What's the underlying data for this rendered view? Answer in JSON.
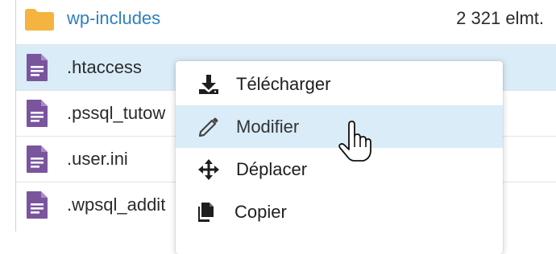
{
  "files": {
    "rows": [
      {
        "name": ".htaccess",
        "type": "file",
        "meta": ""
      },
      {
        "name": ".pssql_tutow",
        "type": "file",
        "meta": ""
      },
      {
        "name": ".user.ini",
        "type": "file",
        "meta": ""
      },
      {
        "name": ".wpsql_addit",
        "type": "file",
        "meta": ""
      }
    ],
    "folder": {
      "name": "wp-includes",
      "meta": "2 321 elmt."
    }
  },
  "context_menu": {
    "items": [
      {
        "label": "Télécharger",
        "icon": "download-icon"
      },
      {
        "label": "Modifier",
        "icon": "pencil-icon"
      },
      {
        "label": "Déplacer",
        "icon": "move-icon"
      },
      {
        "label": "Copier",
        "icon": "copy-icon"
      }
    ]
  },
  "colors": {
    "folder": "#f5b43f",
    "file_icon": "#7a559e",
    "link": "#2e7fc1",
    "highlight": "#d9ecf8"
  }
}
